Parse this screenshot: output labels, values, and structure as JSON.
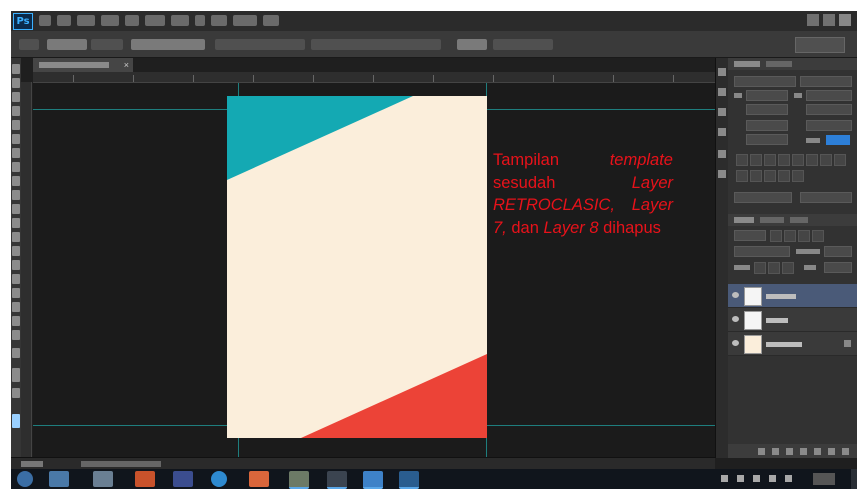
{
  "app": {
    "name": "Photoshop",
    "logo_text": "Ps"
  },
  "document": {
    "tab_close_glyph": "×"
  },
  "annotation": {
    "color": "#e8121a",
    "t1": "Tampilan ",
    "t2": "template",
    "t3": " sesudah ",
    "t4": "Layer RETROCLASIC, Layer 7,",
    "t5": " dan ",
    "t6": "Layer 8",
    "t7": " dihapus"
  },
  "canvas_art": {
    "background": "#fbeedb",
    "teal_shape": "#14a9b3",
    "red_shape": "#ec4337"
  },
  "layers_panel": {
    "selected_color": "#4a5a78"
  },
  "icons": [
    "ps-logo",
    "tool-icons",
    "eye-icon",
    "start-button",
    "folder-icon",
    "chrome-icon",
    "mail-icon",
    "windows-icon",
    "explorer-icon"
  ]
}
